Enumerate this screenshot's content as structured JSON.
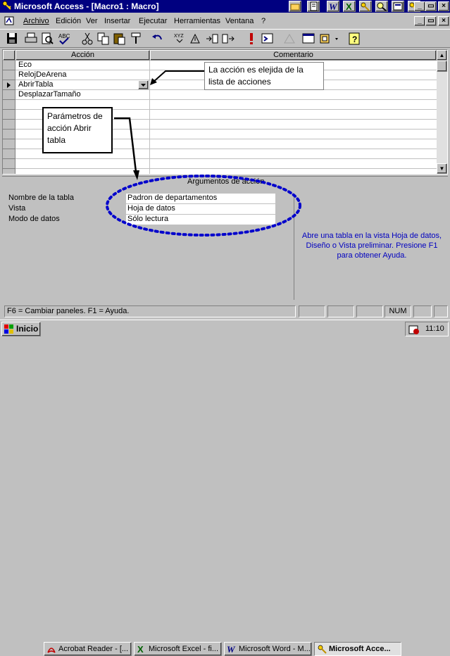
{
  "window": {
    "title": "Microsoft Access - [Macro1 : Macro]"
  },
  "quickbar_icons": [
    "folder-icon",
    "notepad-icon",
    "word-icon",
    "excel-icon",
    "key-icon",
    "search-icon",
    "info-icon",
    "access-icon"
  ],
  "menu": {
    "items": [
      "Archivo",
      "Edición",
      "Ver",
      "Insertar",
      "Ejecutar",
      "Herramientas",
      "Ventana",
      "?"
    ]
  },
  "toolbar": {
    "icons": [
      "save-icon",
      "print-icon",
      "print-preview-icon",
      "spelling-icon",
      "cut-icon",
      "copy-icon",
      "paste-icon",
      "format-painter-icon",
      "undo-icon",
      "macro-names-icon",
      "conditions-icon",
      "insert-row-icon",
      "delete-row-icon",
      "run-icon",
      "step-icon",
      "build-icon",
      "database-window-icon",
      "new-object-icon",
      "help-icon"
    ]
  },
  "grid": {
    "headers": {
      "action": "Acción",
      "comment": "Comentario"
    },
    "rows": [
      {
        "action": "Eco",
        "comment": ""
      },
      {
        "action": "RelojDeArena",
        "comment": ""
      },
      {
        "action": "AbrirTabla",
        "comment": "",
        "current": true
      },
      {
        "action": "DesplazarTamaño",
        "comment": ""
      }
    ]
  },
  "callouts": {
    "list": "La acción es elejida de la lista de acciones",
    "params": "Parámetros de acción Abrir tabla"
  },
  "arguments": {
    "title": "Argumentos de acción",
    "fields": [
      {
        "label": "Nombre de la tabla",
        "value": "Padron de departamentos"
      },
      {
        "label": "Vista",
        "value": "Hoja de datos"
      },
      {
        "label": "Modo de datos",
        "value": "Sólo lectura"
      }
    ],
    "help": "Abre una tabla en la vista Hoja de datos, Diseño o Vista preliminar. Presione F1 para obtener Ayuda."
  },
  "status": {
    "text": "F6 = Cambiar paneles.  F1 = Ayuda.",
    "num": "NUM"
  },
  "taskbar": {
    "start": "Inicio",
    "tasks": [
      "Acrobat Reader - [...",
      "Microsoft Excel - fi...",
      "Microsoft Word - M...",
      "Microsoft Acce..."
    ],
    "time": "11:10"
  },
  "colors": {
    "titlebar": "#000080",
    "help_text": "#0000c0",
    "ellipse": "#0000cc"
  }
}
